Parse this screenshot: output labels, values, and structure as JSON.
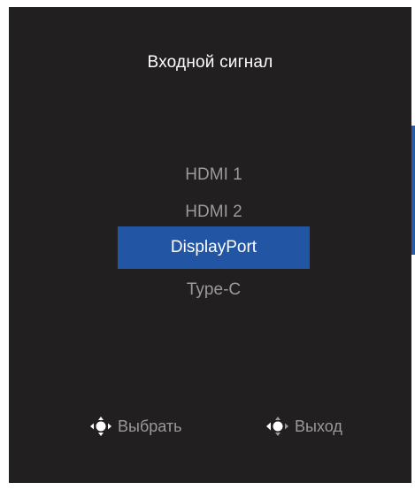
{
  "menu": {
    "title": "Входной сигнал",
    "options": [
      {
        "label": "HDMI 1",
        "selected": false
      },
      {
        "label": "HDMI 2",
        "selected": false
      },
      {
        "label": "DisplayPort",
        "selected": true
      },
      {
        "label": "Type-C",
        "selected": false
      }
    ]
  },
  "footer": {
    "select": {
      "icon": "joystick-press-icon",
      "label": "Выбрать"
    },
    "exit": {
      "icon": "joystick-left-icon",
      "label": "Выход"
    }
  },
  "colors": {
    "background": "#211f20",
    "accent": "#2255a4",
    "text_primary": "#ffffff",
    "text_secondary": "#9a9a9a"
  }
}
